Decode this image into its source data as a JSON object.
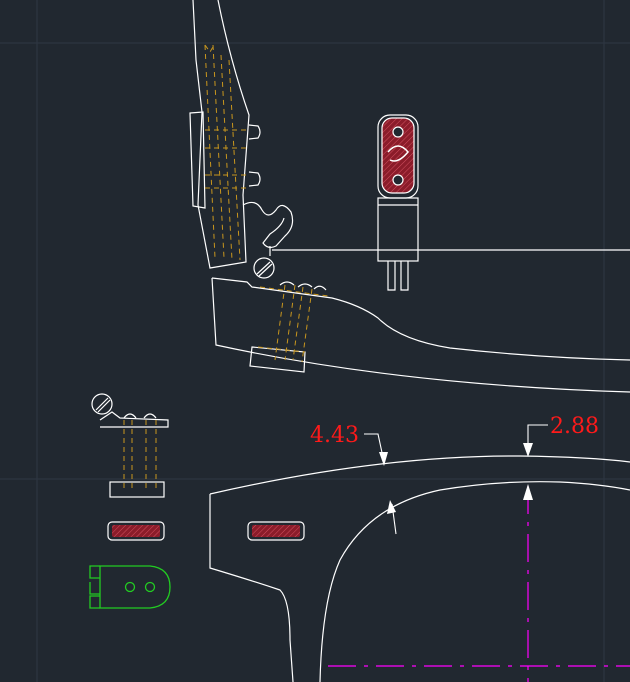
{
  "drawing": {
    "background": "#212830",
    "grid_color": "#2e3743",
    "line_color": "#ffffff",
    "hidden_line_color": "#c8961e",
    "center_line_color": "#ff00ff",
    "accent_green": "#22cc22",
    "hatch_fill": "#8b1c2a",
    "hatch_line": "#d05060"
  },
  "dimensions": {
    "first": {
      "value": "4.43",
      "color": "#ff1a1a"
    },
    "second": {
      "value": "2.88",
      "color": "#ff1a1a"
    }
  }
}
